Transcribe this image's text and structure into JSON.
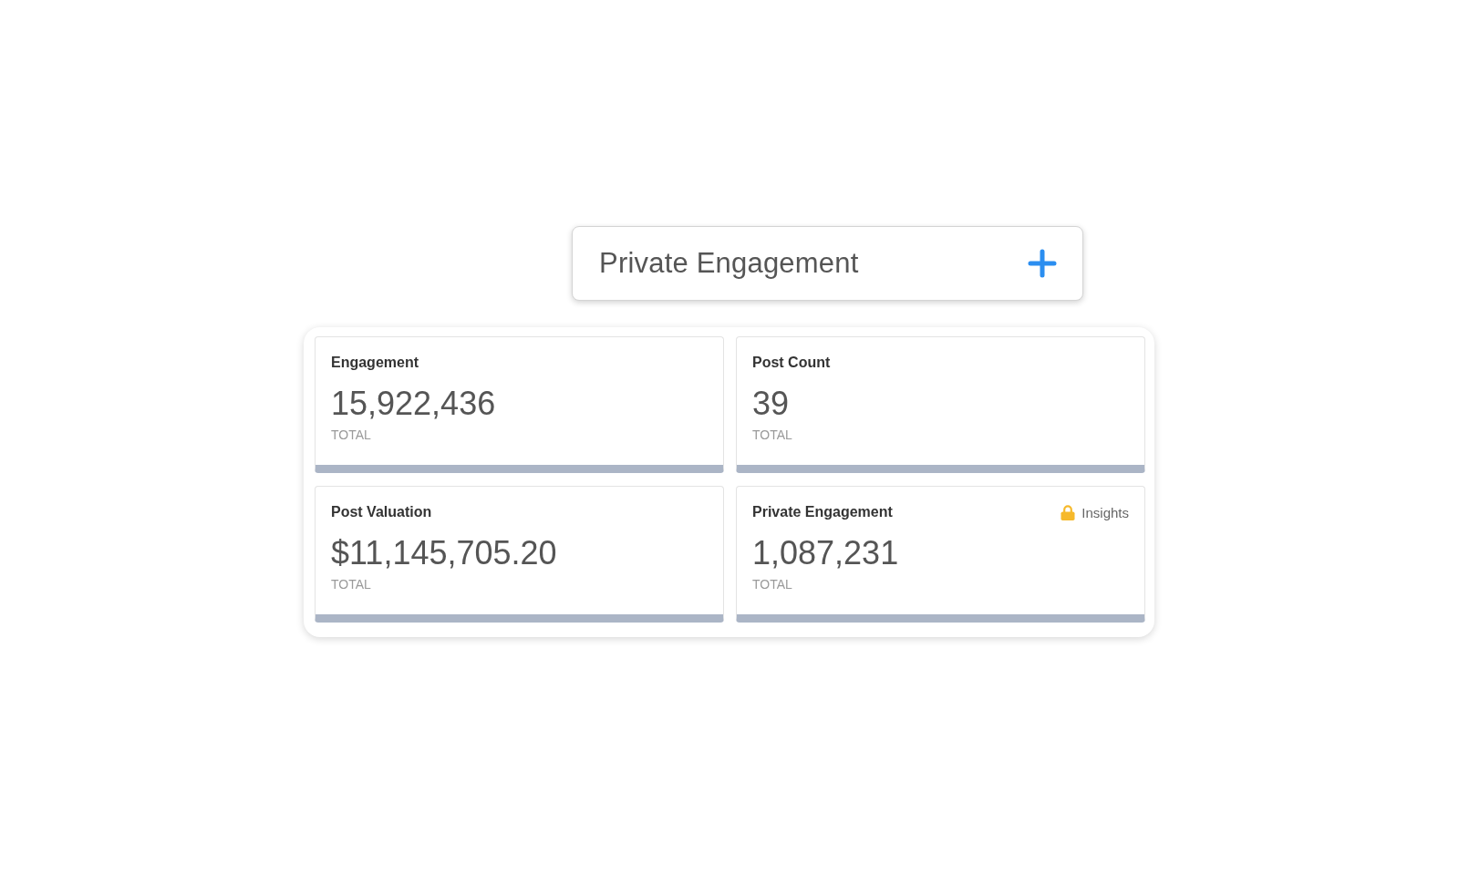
{
  "header": {
    "title": "Private Engagement"
  },
  "metrics": [
    {
      "title": "Engagement",
      "value": "15,922,436",
      "caption": "TOTAL"
    },
    {
      "title": "Post Count",
      "value": "39",
      "caption": "TOTAL"
    },
    {
      "title": "Post Valuation",
      "value": "$11,145,705.20",
      "caption": "TOTAL"
    },
    {
      "title": "Private Engagement",
      "value": "1,087,231",
      "caption": "TOTAL",
      "badge": "Insights"
    }
  ]
}
